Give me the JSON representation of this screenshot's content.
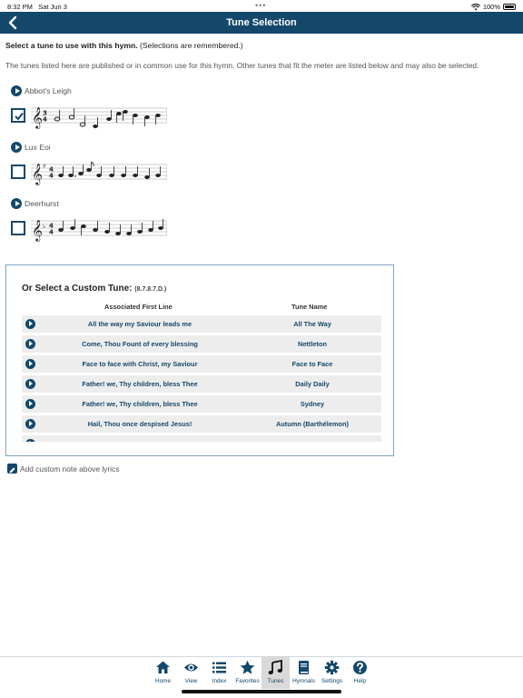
{
  "status": {
    "time": "8:32 PM",
    "date": "Sat Jun 3",
    "battery": "100%"
  },
  "nav": {
    "title": "Tune Selection"
  },
  "instructions": {
    "bold": "Select a tune to use with this hymn.",
    "note": "(Selections are remembered.)"
  },
  "description": "The tunes listed here are published or in common use for this hymn. Other tunes that fit the meter are listed below and may also be selected.",
  "tunes": [
    {
      "name": "Abbot's Leigh",
      "selected": true
    },
    {
      "name": "Lux Eoi",
      "selected": false
    },
    {
      "name": "Deerhurst",
      "selected": false
    }
  ],
  "custom": {
    "title": "Or Select a Custom Tune:",
    "meter": "(8.7.8.7.D.)",
    "col_first_line": "Associated First Line",
    "col_tune_name": "Tune Name",
    "rows": [
      {
        "first_line": "All the way my Saviour leads me",
        "tune": "All The Way"
      },
      {
        "first_line": "Come, Thou Fount of every blessing",
        "tune": "Nettleton"
      },
      {
        "first_line": "Face to face with Christ, my Saviour",
        "tune": "Face to Face"
      },
      {
        "first_line": "Father! we, Thy children, bless Thee",
        "tune": "Daily Daily"
      },
      {
        "first_line": "Father! we, Thy children, bless Thee",
        "tune": "Sydney"
      },
      {
        "first_line": "Hail, Thou once despised Jesus!",
        "tune": "Autumn (Barthélemon)"
      },
      {
        "first_line": "",
        "tune": ""
      }
    ]
  },
  "add_note": "Add custom note above lyrics",
  "tabs": [
    {
      "label": "Home",
      "icon": "home-icon"
    },
    {
      "label": "View",
      "icon": "eye-icon"
    },
    {
      "label": "Index",
      "icon": "list-icon"
    },
    {
      "label": "Favorites",
      "icon": "star-icon"
    },
    {
      "label": "Tunes",
      "icon": "music-note-icon",
      "active": true
    },
    {
      "label": "Hymnals",
      "icon": "book-icon"
    },
    {
      "label": "Settings",
      "icon": "gear-icon"
    },
    {
      "label": "Help",
      "icon": "help-icon"
    }
  ],
  "colors": {
    "primary": "#14486b",
    "row_bg": "#ededed",
    "panel_border": "#7fa5c2"
  }
}
